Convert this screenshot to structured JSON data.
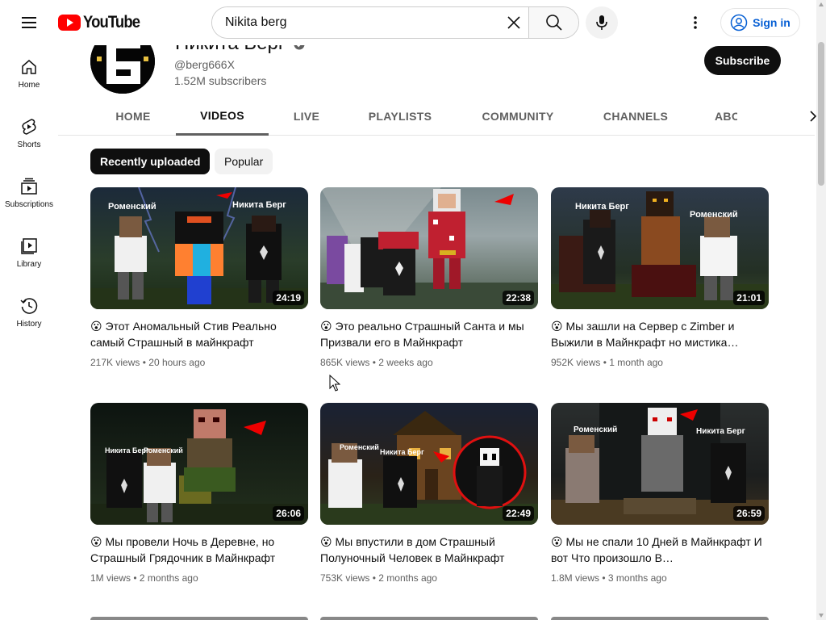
{
  "header": {
    "logo_text": "YouTube",
    "search_value": "Nikita berg",
    "signin_label": "Sign in"
  },
  "rail": [
    {
      "label": "Home",
      "icon": "home-icon"
    },
    {
      "label": "Shorts",
      "icon": "shorts-icon"
    },
    {
      "label": "Subscriptions",
      "icon": "subscriptions-icon"
    },
    {
      "label": "Library",
      "icon": "library-icon"
    },
    {
      "label": "History",
      "icon": "history-icon"
    }
  ],
  "channel": {
    "name": "Никита Берг",
    "handle": "@berg666X",
    "subscribers": "1.52M subscribers",
    "subscribe_label": "Subscribe"
  },
  "tabs": [
    "HOME",
    "VIDEOS",
    "LIVE",
    "PLAYLISTS",
    "COMMUNITY",
    "CHANNELS",
    "ABOUT"
  ],
  "active_tab": "VIDEOS",
  "chips": [
    "Recently uploaded",
    "Popular"
  ],
  "videos": [
    {
      "title": "😮 Этот Аномальный Стив Реально самый Страшный в майнкрафт",
      "views": "217K views",
      "age": "20 hours ago",
      "duration": "24:19",
      "thumb_labels": [
        "Роменский",
        "Никита Берг"
      ]
    },
    {
      "title": "😮 Это реально Страшный Санта и мы Призвали его в Майнкрафт",
      "views": "865K views",
      "age": "2 weeks ago",
      "duration": "22:38",
      "thumb_labels": []
    },
    {
      "title": "😮 Мы зашли на Сервер с Zimber и Выжили в Майнкрафт но мистика…",
      "views": "952K views",
      "age": "1 month ago",
      "duration": "21:01",
      "thumb_labels": [
        "Никита Берг",
        "Роменский"
      ]
    },
    {
      "title": "😮 Мы провели Ночь в Деревне, но Страшный Грядочник в Майнкрафт",
      "views": "1M views",
      "age": "2 months ago",
      "duration": "26:06",
      "thumb_labels": [
        "Никита Берг",
        "Роменский"
      ]
    },
    {
      "title": "😮 Мы впустили в дом Страшный Полуночный Человек в Майнкрафт",
      "views": "753K views",
      "age": "2 months ago",
      "duration": "22:49",
      "thumb_labels": [
        "Роменский",
        "Никита Берг"
      ]
    },
    {
      "title": "😮 Мы не спали 10 Дней в Майнкрафт И вот Что произошло В…",
      "views": "1.8M views",
      "age": "3 months ago",
      "duration": "26:59",
      "thumb_labels": [
        "Роменский",
        "Никита Берг"
      ]
    }
  ],
  "meta_separator": "•"
}
